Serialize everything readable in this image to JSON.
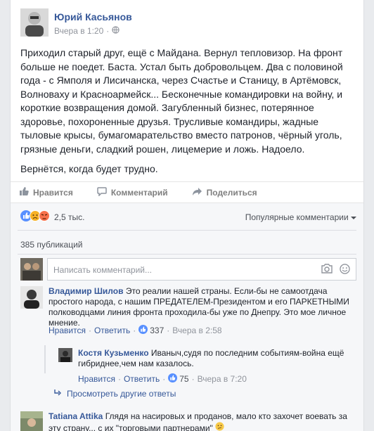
{
  "post": {
    "author": "Юрий Касьянов",
    "time": "Вчера в 1:20",
    "paragraphs": [
      "Приходил старый друг, ещё с Майдана. Вернул тепловизор. На фронт больше не поедет. Баста. Устал быть добровольцем. Два с половиной года - с Ямполя и Лисичанска, через Счастье и Станицу, в Артёмовск, Волноваху и Красноармейск... Бесконечные командировки на войну, и короткие возвращения домой. Загубленный бизнес, потерянное здоровье, похороненные друзья. Трусливые командиры, жадные тыловые крысы, бумагомарательство вместо патронов, чёрный уголь, грязные деньги, сладкий рошен, лицемерие и ложь. Надоело.",
      "Вернётся, когда будет трудно."
    ]
  },
  "actions": {
    "like": "Нравится",
    "comment": "Комментарий",
    "share": "Поделиться"
  },
  "reactions": {
    "count": "2,5 тыс.",
    "sort_label": "Популярные комментарии"
  },
  "publications": "385 публикаций",
  "comment_input": {
    "placeholder": "Написать комментарий..."
  },
  "comments": [
    {
      "author": "Владимир Шилов",
      "text": "Это реалии нашей страны. Если-бы не самоотдача простого народа, с нашим ПРЕДАТЕЛЕМ-Президентом и его ПАРКЕТНЫМИ полководцами линия фронта проходила-бы уже по Днепру. Это мое личное мнение.",
      "like": "Нравится",
      "reply": "Ответить",
      "likes": "337",
      "time": "Вчера в 2:58"
    },
    {
      "author": "Костя Кузьменко",
      "text": "Иваныч,судя по последним событиям-война ещё гибриднее,чем нам казалось.",
      "like": "Нравится",
      "reply": "Ответить",
      "likes": "75",
      "time": "Вчера в 7:20"
    },
    {
      "author": "Tatiana Attika",
      "text": "Глядя на насировых и проданов, мало кто захочет воевать за эту страну... с их \"торговыми партнерами\""
    }
  ],
  "more_replies": "Просмотреть другие ответы",
  "separator": "·",
  "colors": {
    "link": "#365899",
    "like_blue": "#5890ff",
    "angry_orange": "#f7714c",
    "sad_yellow": "#f7b125"
  }
}
